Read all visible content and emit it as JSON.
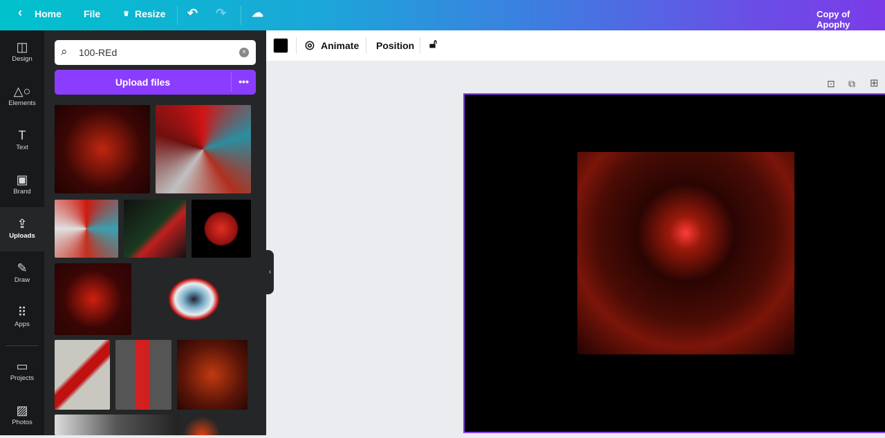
{
  "topbar": {
    "home": "Home",
    "file": "File",
    "resize": "Resize",
    "title": "Copy of Apophy"
  },
  "rail": [
    {
      "label": "Design",
      "icon": "layout-icon"
    },
    {
      "label": "Elements",
      "icon": "shapes-icon"
    },
    {
      "label": "Text",
      "icon": "text-icon"
    },
    {
      "label": "Brand",
      "icon": "brand-icon"
    },
    {
      "label": "Uploads",
      "icon": "upload-cloud-icon"
    },
    {
      "label": "Draw",
      "icon": "draw-icon"
    },
    {
      "label": "Apps",
      "icon": "apps-icon"
    },
    {
      "label": "Projects",
      "icon": "folder-icon"
    },
    {
      "label": "Photos",
      "icon": "photo-icon"
    }
  ],
  "panel": {
    "search_value": "100-REd",
    "upload_label": "Upload files",
    "more": "•••"
  },
  "toolbar": {
    "color": "#000000",
    "animate": "Animate",
    "position": "Position"
  },
  "colors": {
    "accent": "#8b3dff"
  }
}
